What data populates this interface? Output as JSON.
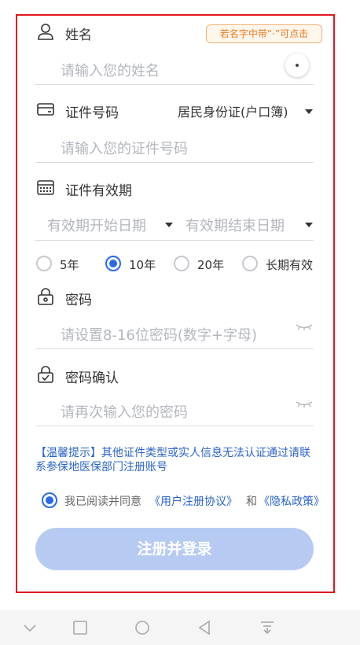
{
  "name_field": {
    "label": "姓名",
    "placeholder": "请输入您的姓名",
    "tooltip": "若名字中带“·”可点击",
    "dot_button": "·"
  },
  "id_field": {
    "label": "证件号码",
    "type_selected": "居民身份证(户口簿)",
    "placeholder": "请输入您的证件号码"
  },
  "validity": {
    "label": "证件有效期",
    "start_placeholder": "有效期开始日期",
    "end_placeholder": "有效期结束日期",
    "options": [
      {
        "label": "5年",
        "selected": false
      },
      {
        "label": "10年",
        "selected": true
      },
      {
        "label": "20年",
        "selected": false
      },
      {
        "label": "长期有效",
        "selected": false
      }
    ]
  },
  "password": {
    "label": "密码",
    "placeholder": "请设置8-16位密码(数字+字母)"
  },
  "confirm_password": {
    "label": "密码确认",
    "placeholder": "请再次输入您的密码"
  },
  "tip": {
    "text": "【温馨提示】其他证件类型或实人信息无法认证通过请联系参保地医保部门注册账号"
  },
  "agreement": {
    "checked": true,
    "prefix": "我已阅读并同意",
    "user_agreement": "《用户注册协议》",
    "and": "和",
    "privacy": "《隐私政策》"
  },
  "submit_button": {
    "label": "注册并登录"
  },
  "colors": {
    "accent": "#2a6be6",
    "highlight_border": "#e0161e",
    "button_disabled": "#b7cbf2",
    "tooltip": "#ee7a1c"
  },
  "nav_icons": [
    "chevron-down-icon",
    "square-icon",
    "circle-icon",
    "back-triangle-icon",
    "download-tray-icon"
  ]
}
